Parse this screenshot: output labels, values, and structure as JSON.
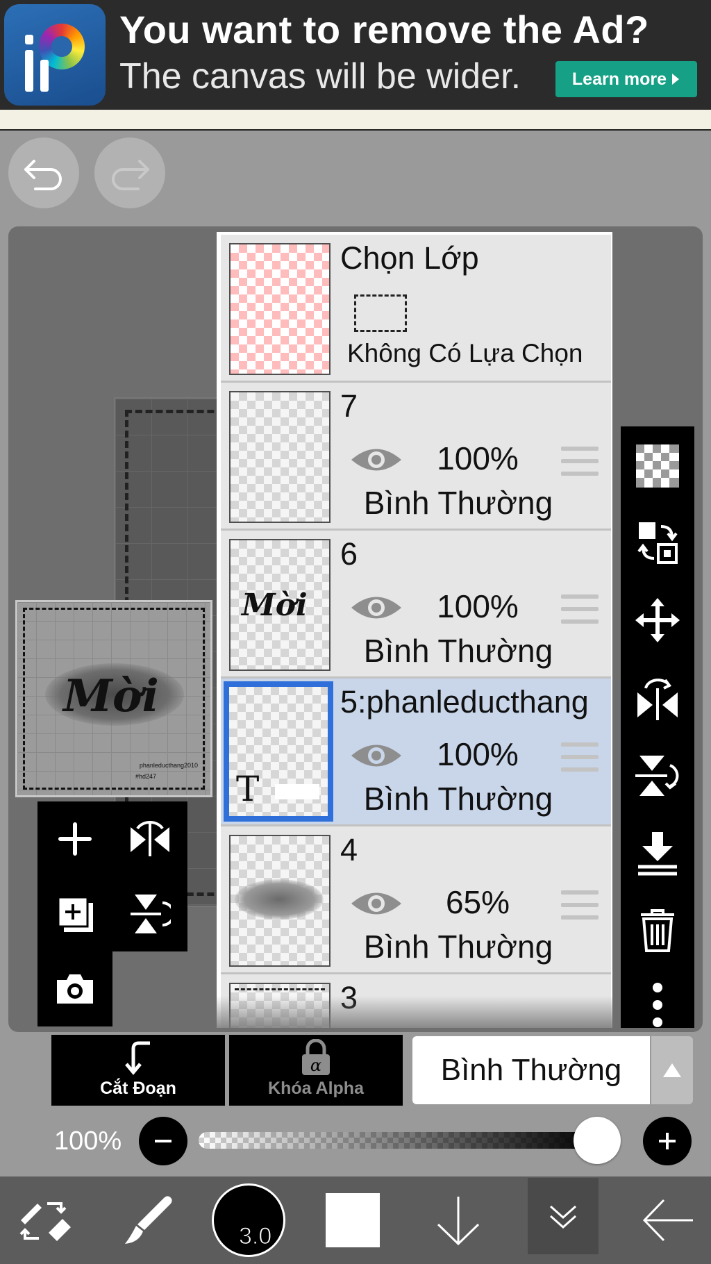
{
  "ad": {
    "title": "You want to remove the Ad?",
    "subtitle": "The canvas will be wider.",
    "button_label": "Learn more",
    "button_color": "#16a085"
  },
  "canvas_preview": {
    "art_text": "Mời",
    "credit": "phanleducthang2010",
    "tag": "#hd247"
  },
  "layers": {
    "selection_row": {
      "title": "Chọn Lớp",
      "status": "Không Có Lựa Chọn"
    },
    "items": [
      {
        "name": "7",
        "opacity": "100%",
        "blend": "Bình Thường",
        "selected": false
      },
      {
        "name": "6",
        "opacity": "100%",
        "blend": "Bình Thường",
        "selected": false,
        "thumb_text": "Mời"
      },
      {
        "name": "5:phanleducthang",
        "opacity": "100%",
        "blend": "Bình Thường",
        "selected": true,
        "thumb_text": "T"
      },
      {
        "name": "4",
        "opacity": "65%",
        "blend": "Bình Thường",
        "selected": false
      },
      {
        "name": "3"
      }
    ],
    "selected_color": "#2f6fd9"
  },
  "bottom_controls": {
    "clip_label": "Cắt Đoạn",
    "alpha_lock_label": "Khóa Alpha",
    "blend_mode": "Bình Thường",
    "opacity_label": "100%",
    "opacity_value": 1.0
  },
  "toolbar": {
    "brush_size": "3.0"
  }
}
